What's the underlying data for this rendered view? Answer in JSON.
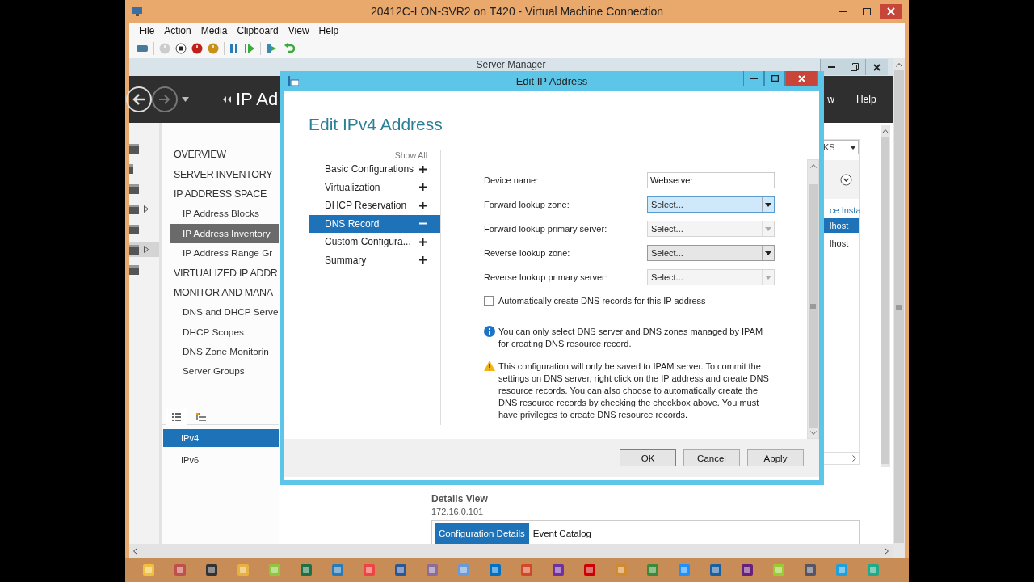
{
  "vm_window": {
    "title": "20412C-LON-SVR2 on T420 - Virtual Machine Connection",
    "menu": [
      "File",
      "Action",
      "Media",
      "Clipboard",
      "View",
      "Help"
    ]
  },
  "server_manager": {
    "title": "Server Manager",
    "page_title": "IP Ad",
    "header_links": [
      "w",
      "Help"
    ],
    "nav": [
      {
        "label": "OVERVIEW",
        "selected": false
      },
      {
        "label": "SERVER INVENTORY",
        "selected": false
      },
      {
        "label": "IP ADDRESS SPACE",
        "selected": false,
        "children": [
          {
            "label": "IP Address Blocks",
            "selected": false
          },
          {
            "label": "IP Address Inventory",
            "selected": true
          },
          {
            "label": "IP Address Range Gr",
            "selected": false
          }
        ]
      },
      {
        "label": "VIRTUALIZED IP ADDR",
        "selected": false
      },
      {
        "label": "MONITOR AND MANA",
        "selected": false,
        "children": [
          {
            "label": "DNS and DHCP Serve",
            "selected": false
          },
          {
            "label": "DHCP Scopes",
            "selected": false
          },
          {
            "label": "DNS Zone Monitorin",
            "selected": false
          },
          {
            "label": "Server Groups",
            "selected": false
          }
        ]
      }
    ],
    "view_tabs": [
      {
        "kind": "list",
        "selected": true
      },
      {
        "kind": "tree",
        "selected": false
      }
    ],
    "address_families": [
      {
        "label": "IPv4",
        "selected": true
      },
      {
        "label": "IPv6",
        "selected": false
      }
    ],
    "tasks_panel": {
      "tasks": "KS",
      "link": "ce Insta",
      "rows": [
        {
          "label": "lhost",
          "selected": true
        },
        {
          "label": "lhost",
          "selected": false
        }
      ]
    },
    "details": {
      "title": "Details View",
      "address": "172.16.0.101",
      "tabs": [
        {
          "label": "Configuration Details",
          "selected": true
        },
        {
          "label": "Event Catalog",
          "selected": false
        }
      ]
    }
  },
  "dialog": {
    "title": "Edit IP Address",
    "heading": "Edit IPv4 Address",
    "show_all": "Show All",
    "sections": [
      {
        "label": "Basic Configurations",
        "selected": false,
        "expanded": false
      },
      {
        "label": "Virtualization",
        "selected": false,
        "expanded": false
      },
      {
        "label": "DHCP Reservation",
        "selected": false,
        "expanded": false
      },
      {
        "label": "DNS Record",
        "selected": true,
        "expanded": true
      },
      {
        "label": "Custom Configura...",
        "selected": false,
        "expanded": false
      },
      {
        "label": "Summary",
        "selected": false,
        "expanded": false
      }
    ],
    "fields": [
      {
        "kind": "text",
        "label": "Device name:",
        "value": "Webserver"
      },
      {
        "kind": "select",
        "label": "Forward lookup zone:",
        "value": "Select...",
        "disabled": false,
        "highlighted": true
      },
      {
        "kind": "select",
        "label": "Forward lookup primary server:",
        "value": "Select...",
        "disabled": true,
        "highlighted": false
      },
      {
        "kind": "select",
        "label": "Reverse lookup zone:",
        "value": "Select...",
        "disabled": false,
        "highlighted": false
      },
      {
        "kind": "select",
        "label": "Reverse lookup primary server:",
        "value": "Select...",
        "disabled": true,
        "highlighted": false
      }
    ],
    "auto_create": {
      "label": "Automatically create DNS records for this IP address",
      "checked": false
    },
    "notes": [
      {
        "kind": "info",
        "text": "You can only select DNS server and DNS zones managed by IPAM for creating DNS resource record."
      },
      {
        "kind": "warning",
        "text": "This configuration will only be saved to IPAM server. To commit the settings on DNS server, right click on the IP address and create DNS resource records. You can also choose to automatically create the DNS resource records by checking the checkbox above. You must have privileges to create DNS resource records."
      }
    ],
    "buttons": [
      {
        "label": "OK",
        "default": true
      },
      {
        "label": "Cancel",
        "default": false
      },
      {
        "label": "Apply",
        "default": false
      }
    ]
  }
}
